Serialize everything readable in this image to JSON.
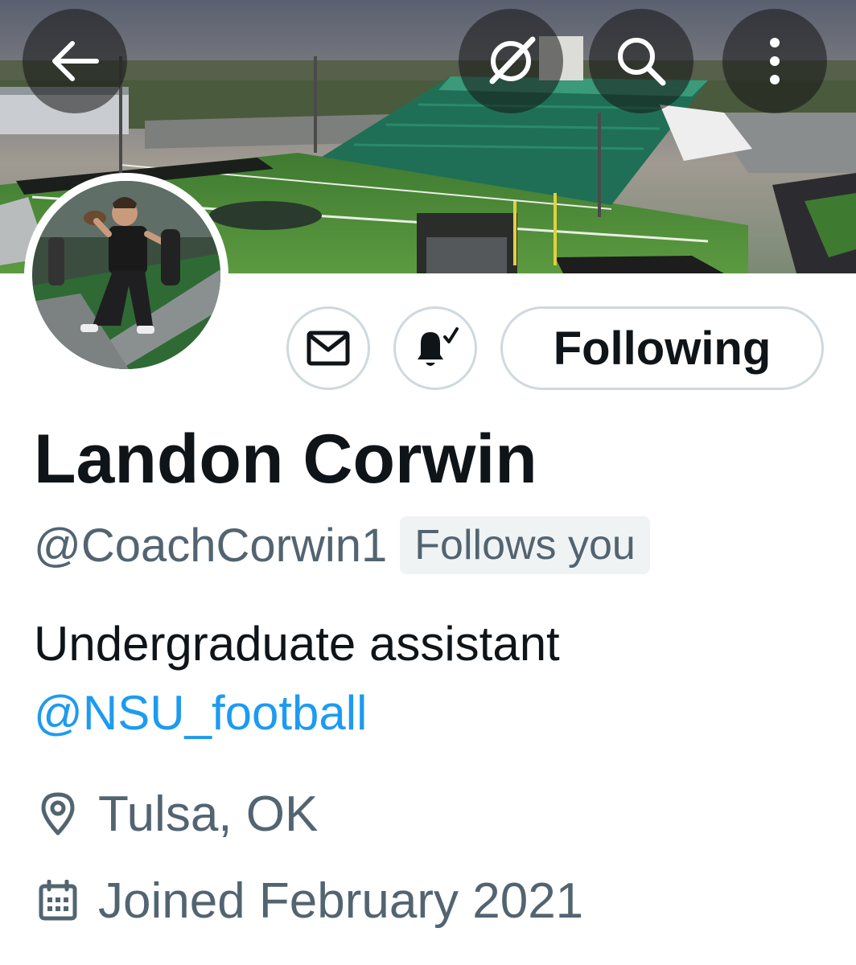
{
  "header": {
    "back_icon": "arrow-left-icon",
    "grok_icon": "grok-icon",
    "search_icon": "search-icon",
    "more_icon": "more-vertical-icon"
  },
  "banner": {
    "description_colors": {
      "sky": "#7f8697",
      "turf": "#4e8a3a",
      "stands": "#1f6f56"
    }
  },
  "actions": {
    "message_icon": "envelope-icon",
    "notify_icon": "bell-check-icon",
    "following_label": "Following"
  },
  "profile": {
    "display_name": "Landon Corwin",
    "handle": "@CoachCorwin1",
    "follows_you": "Follows you",
    "bio_text": "Undergraduate assistant",
    "bio_mention": "@NSU_football",
    "location": "Tulsa, OK",
    "joined": "Joined February 2021"
  },
  "colors": {
    "text_primary": "#0f1419",
    "text_secondary": "#536471",
    "link": "#1d9bf0",
    "border": "#cfd9de",
    "badge_bg": "#eff3f4"
  }
}
